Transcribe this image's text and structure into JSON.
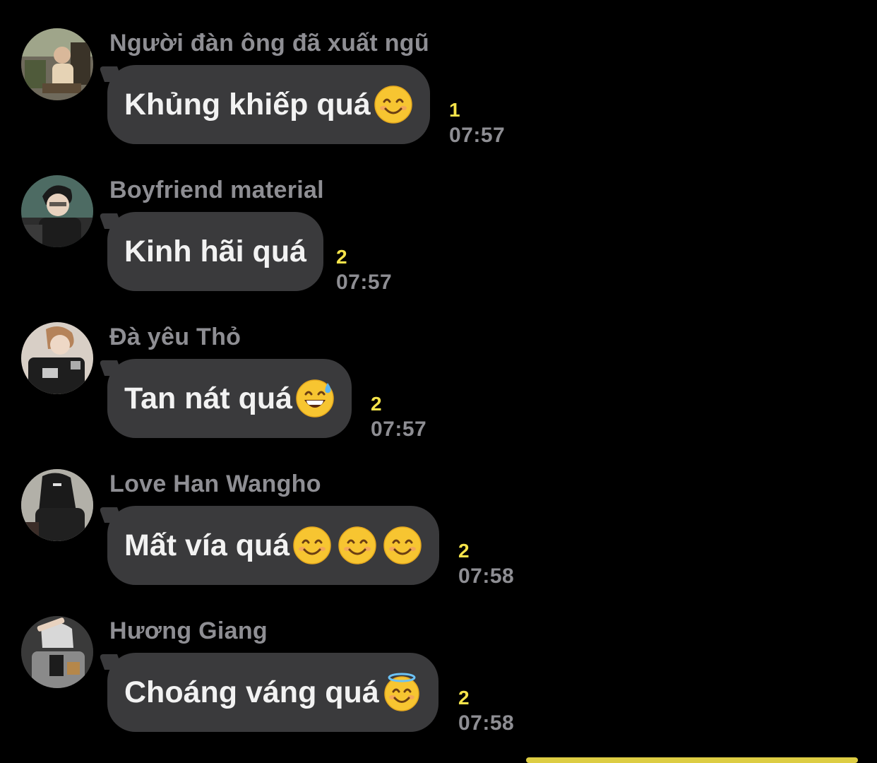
{
  "messages": [
    {
      "sender": "Người đàn ông đã xuất ngũ",
      "text": "Khủng khiếp quá",
      "emojis": [
        "smiling-face-with-smiling-eyes"
      ],
      "unread": "1",
      "time": "07:57"
    },
    {
      "sender": "Boyfriend material",
      "text": "Kinh hãi quá",
      "emojis": [],
      "unread": "2",
      "time": "07:57"
    },
    {
      "sender": "Đà yêu Thỏ",
      "text": "Tan nát quá",
      "emojis": [
        "grinning-face-with-sweat"
      ],
      "unread": "2",
      "time": "07:57"
    },
    {
      "sender": "Love Han Wangho",
      "text": "Mất vía quá",
      "emojis": [
        "smiling-face-with-smiling-eyes",
        "smiling-face-with-smiling-eyes",
        "smiling-face-with-smiling-eyes"
      ],
      "unread": "2",
      "time": "07:58"
    },
    {
      "sender": "Hương Giang",
      "text": "Choáng váng quá",
      "emojis": [
        "smiling-face-with-halo"
      ],
      "unread": "2",
      "time": "07:58"
    }
  ],
  "colors": {
    "background": "#000000",
    "bubble": "#3a3a3c",
    "sender": "#8e8e93",
    "unread": "#f5e34a",
    "time": "#8e8e93"
  }
}
